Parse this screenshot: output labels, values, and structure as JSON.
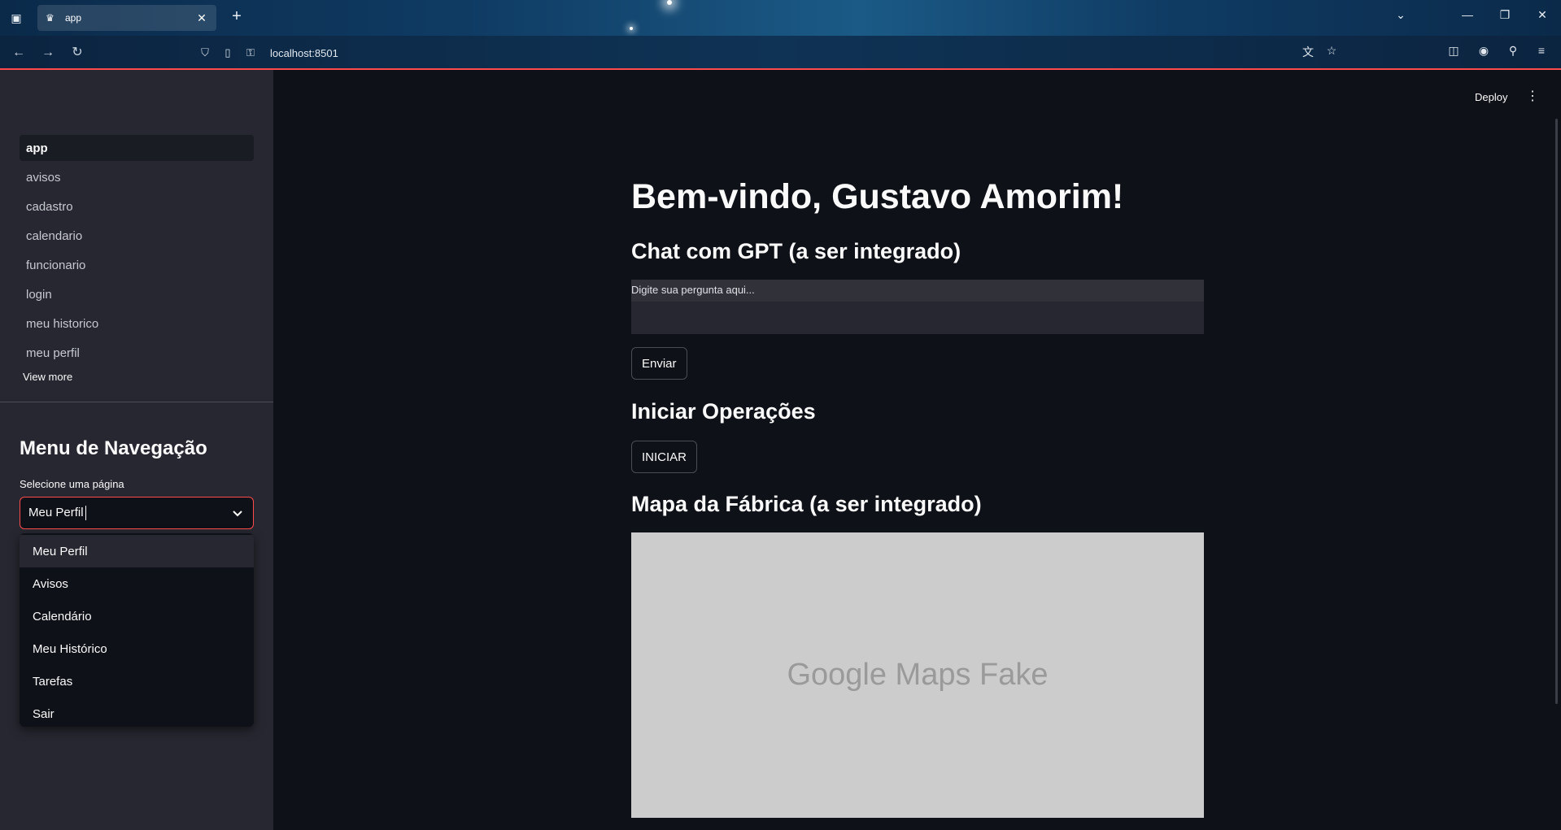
{
  "browser": {
    "tab_title": "app",
    "url": "localhost:8501",
    "colors": {
      "accent": "#ff4b4b"
    }
  },
  "sidebar": {
    "nav_items": [
      {
        "label": "app",
        "active": true
      },
      {
        "label": "avisos"
      },
      {
        "label": "cadastro"
      },
      {
        "label": "calendario"
      },
      {
        "label": "funcionario"
      },
      {
        "label": "login"
      },
      {
        "label": "meu historico"
      },
      {
        "label": "meu perfil"
      }
    ],
    "view_more": "View more",
    "menu_title": "Menu de Navegação",
    "select_label": "Selecione uma página",
    "select_value": "Meu Perfil",
    "options": [
      "Meu Perfil",
      "Avisos",
      "Calendário",
      "Meu Histórico",
      "Tarefas",
      "Sair"
    ]
  },
  "header": {
    "deploy_label": "Deploy"
  },
  "main": {
    "welcome": "Bem-vindo, Gustavo Amorim!",
    "chat_title": "Chat com GPT (a ser integrado)",
    "chat_placeholder": "Digite sua pergunta aqui...",
    "send_label": "Enviar",
    "ops_title": "Iniciar Operações",
    "start_label": "INICIAR",
    "map_title": "Mapa da Fábrica (a ser integrado)",
    "map_text": "Google Maps Fake"
  }
}
